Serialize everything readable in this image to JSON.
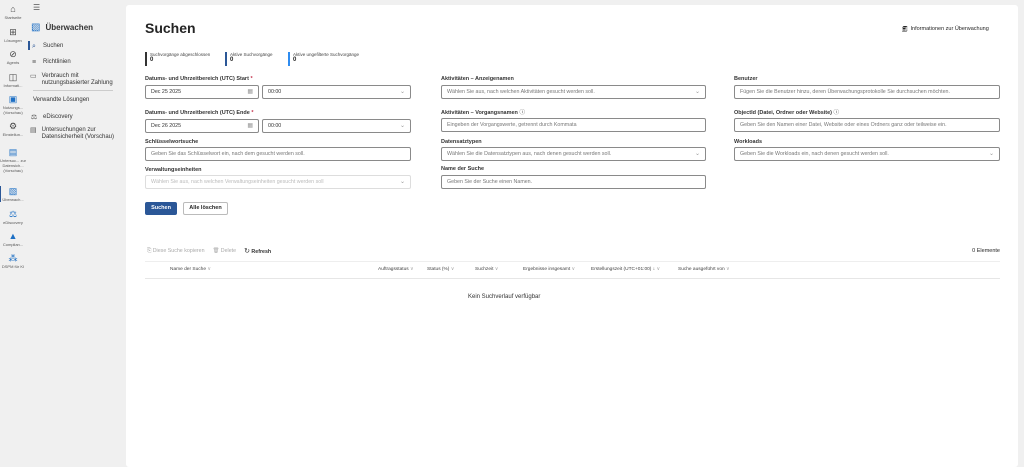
{
  "rail": [
    {
      "label": "Startseite",
      "icon": "home-icon"
    },
    {
      "label": "Lösungen",
      "icon": "grid-icon"
    },
    {
      "label": "Agents",
      "icon": "agents-icon"
    },
    {
      "label": "Informati...",
      "icon": "book-icon"
    },
    {
      "label": "Nutzungs... (Vorschau)",
      "icon": "usage-icon"
    },
    {
      "label": "Einstellun...",
      "icon": "gear-icon"
    },
    {
      "label": "Untersuc... zur Datensich... (Vorschau)",
      "icon": "investigation-icon"
    },
    {
      "label": "Überwach...",
      "icon": "audit-icon"
    },
    {
      "label": "eDiscovery",
      "icon": "ediscovery-icon"
    },
    {
      "label": "Complian...",
      "icon": "warning-icon"
    },
    {
      "label": "DSPM für KI",
      "icon": "dspm-icon"
    }
  ],
  "nav": {
    "title": "Überwachen",
    "items": [
      {
        "label": "Suchen"
      },
      {
        "label": "Richtlinien"
      },
      {
        "label": "Verbrauch mit nutzungsbasierter Zahlung"
      }
    ],
    "related_heading": "Verwandte Lösungen",
    "related": [
      {
        "label": "eDiscovery"
      },
      {
        "label": "Untersuchungen zur Datensicherheit (Vorschau)"
      }
    ]
  },
  "page": {
    "title": "Suchen",
    "info_link": "Informationen zur Überwachung"
  },
  "stats": [
    {
      "label": "Suchvorgänge abgeschlossen",
      "value": "0",
      "color": "#333333"
    },
    {
      "label": "Aktive Suchvorgänge",
      "value": "0",
      "color": "#2b5797"
    },
    {
      "label": "Aktive ungefilterte Suchvorgänge",
      "value": "0",
      "color": "#2f8cf0"
    }
  ],
  "form": {
    "start_label": "Datums- und Uhrzeitbereich (UTC) Start",
    "start_date": "Dec 25 2025",
    "start_time": "00:00",
    "end_label": "Datums- und Uhrzeitbereich (UTC) Ende",
    "end_date": "Dec 26 2025",
    "end_time": "00:00",
    "required_mark": "*",
    "keyword_label": "Schlüsselwortsuche",
    "keyword_placeholder": "Geben Sie das Schlüsselwort ein, nach dem gesucht werden soll.",
    "units_label": "Verwaltungseinheiten",
    "units_placeholder": "Wählen Sie aus, nach welchen Verwaltungseinheiten gesucht werden soll",
    "activities_label": "Aktivitäten – Anzeigenamen",
    "activities_placeholder": "Wählen Sie aus, nach welchen Aktivitäten gesucht werden soll.",
    "operations_label": "Aktivitäten – Vorgangsnamen",
    "operations_placeholder": "Eingeben der Vorgangswerte, getrennt durch Kommata",
    "record_label": "Datensatztypen",
    "record_placeholder": "Wählen Sie die Datensatztypen aus, nach denen gesucht werden soll.",
    "name_label": "Name der Suche",
    "name_placeholder": "Geben Sie der Suche einen Namen.",
    "users_label": "Benutzer",
    "users_placeholder": "Fügen Sie die Benutzer hinzu, deren Überwachungsprotokolle Sie durchsuchen möchten.",
    "object_label": "ObjectId (Datei, Ordner oder Website)",
    "object_placeholder": "Geben Sie den Namen einer Datei, Website oder eines Ordners ganz oder teilweise ein.",
    "workloads_label": "Workloads",
    "workloads_placeholder": "Geben Sie die Workloads ein, nach denen gesucht werden soll.",
    "search_button": "Suchen",
    "clear_button": "Alle löschen"
  },
  "toolbar": {
    "copy": "Diese Suche kopieren",
    "delete": "Delete",
    "refresh": "Refresh",
    "count": "0 Elemente"
  },
  "table": {
    "columns": [
      "Name der Suche",
      "Auftragsstatus",
      "Status (%)",
      "Suchzeit",
      "Ergebnisse insgesamt",
      "Erstellungszeit (UTC+01:00) ↓",
      "Suche ausgeführt von"
    ],
    "empty": "Kein Suchverlauf verfügbar"
  },
  "colors": {
    "accent": "#2b5797",
    "primary_button": "#2b5797"
  }
}
